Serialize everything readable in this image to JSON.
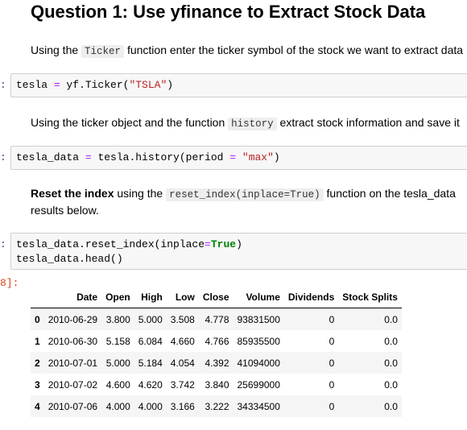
{
  "heading": "Question 1: Use yfinance to Extract Stock Data",
  "md1": {
    "pre": "Using the ",
    "code": "Ticker",
    "post": " function enter the ticker symbol of the stock we want to extract data"
  },
  "cell1": {
    "prompt": ":",
    "lhs": "tesla ",
    "op": "=",
    "rhs": " yf.Ticker(",
    "str": "\"TSLA\"",
    "end": ")"
  },
  "md2": {
    "pre": "Using the ticker object and the function ",
    "code": "history",
    "post": " extract stock information and save it"
  },
  "cell2": {
    "prompt": ":",
    "lhs": "tesla_data ",
    "op": "=",
    "mid": " tesla.history(period ",
    "op2": "=",
    "sp": " ",
    "str": "\"max\"",
    "end": ")"
  },
  "md3": {
    "bold": "Reset the index",
    "pre": " using the ",
    "code": "reset_index(inplace=True)",
    "post": " function on the tesla_data",
    "line2": "results below."
  },
  "cell3": {
    "prompt": ":",
    "l1a": "tesla_data.reset_index(inplace",
    "l1op": "=",
    "l1kw": "True",
    "l1end": ")",
    "l2": "tesla_data.head()"
  },
  "out_prompt": "8]:",
  "table": {
    "columns": [
      "",
      "Date",
      "Open",
      "High",
      "Low",
      "Close",
      "Volume",
      "Dividends",
      "Stock Splits"
    ],
    "rows": [
      [
        "0",
        "2010-06-29",
        "3.800",
        "5.000",
        "3.508",
        "4.778",
        "93831500",
        "0",
        "0.0"
      ],
      [
        "1",
        "2010-06-30",
        "5.158",
        "6.084",
        "4.660",
        "4.766",
        "85935500",
        "0",
        "0.0"
      ],
      [
        "2",
        "2010-07-01",
        "5.000",
        "5.184",
        "4.054",
        "4.392",
        "41094000",
        "0",
        "0.0"
      ],
      [
        "3",
        "2010-07-02",
        "4.600",
        "4.620",
        "3.742",
        "3.840",
        "25699000",
        "0",
        "0.0"
      ],
      [
        "4",
        "2010-07-06",
        "4.000",
        "4.000",
        "3.166",
        "3.222",
        "34334500",
        "0",
        "0.0"
      ]
    ]
  }
}
